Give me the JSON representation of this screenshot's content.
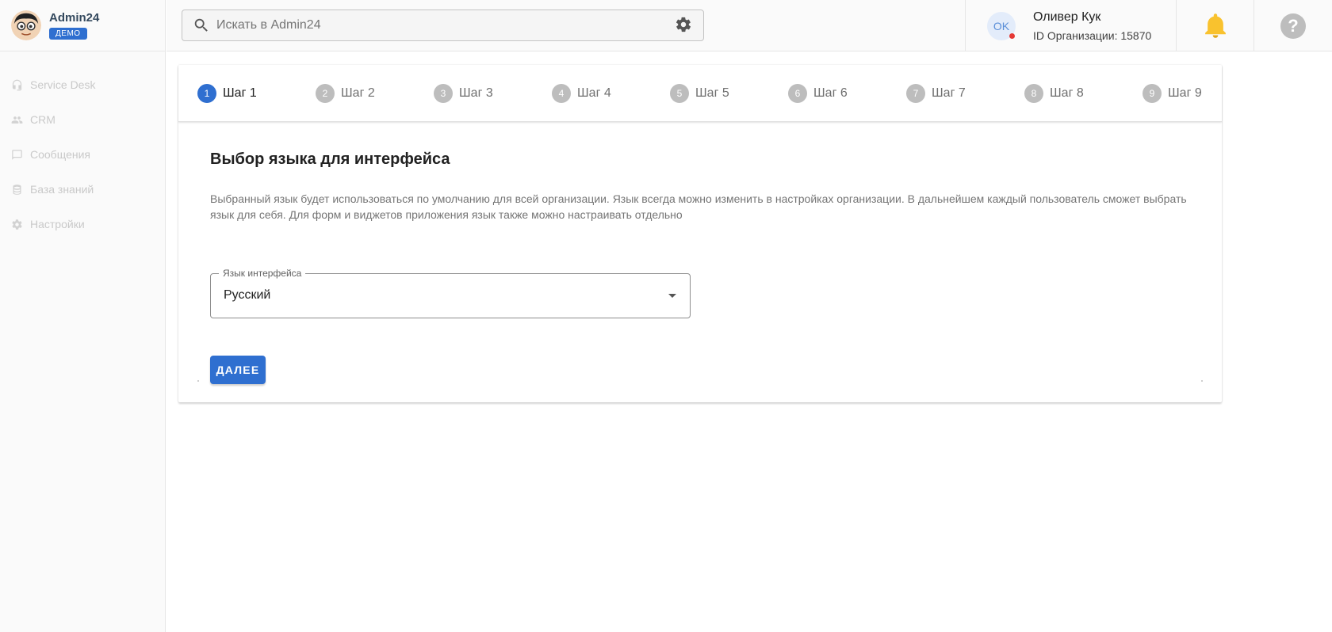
{
  "brand": {
    "name": "Admin24",
    "badge": "ДЕМО"
  },
  "sidebar": {
    "items": [
      {
        "label": "Service Desk",
        "icon": "headset-icon"
      },
      {
        "label": "CRM",
        "icon": "people-icon"
      },
      {
        "label": "Сообщения",
        "icon": "chat-icon"
      },
      {
        "label": "База знаний",
        "icon": "database-icon"
      },
      {
        "label": "Настройки",
        "icon": "gear-icon"
      }
    ]
  },
  "search": {
    "placeholder": "Искать в Admin24",
    "value": ""
  },
  "user": {
    "initials": "OK",
    "name": "Оливер Кук",
    "org_id": "ID Организации: 15870"
  },
  "help": {
    "glyph": "?"
  },
  "stepper": {
    "active_index": 0,
    "steps": [
      {
        "num": "1",
        "label": "Шаг 1"
      },
      {
        "num": "2",
        "label": "Шаг 2"
      },
      {
        "num": "3",
        "label": "Шаг 3"
      },
      {
        "num": "4",
        "label": "Шаг 4"
      },
      {
        "num": "5",
        "label": "Шаг 5"
      },
      {
        "num": "6",
        "label": "Шаг 6"
      },
      {
        "num": "7",
        "label": "Шаг 7"
      },
      {
        "num": "8",
        "label": "Шаг 8"
      },
      {
        "num": "9",
        "label": "Шаг 9"
      }
    ]
  },
  "main": {
    "title": "Выбор языка для интерфейса",
    "description": "Выбранный язык будет использоваться по умолчанию для всей организации. Язык всегда можно изменить в настройках организации. В дальнейшем каждый пользователь сможет выбрать язык для себя. Для форм и виджетов приложения язык также можно настраивать отдельно",
    "language_select": {
      "label": "Язык интерфейса",
      "value": "Русский"
    },
    "next_label": "ДАЛЕЕ"
  },
  "colors": {
    "accent": "#2f6fd0",
    "bell": "#f9c22e",
    "status_dot": "#e53935"
  }
}
